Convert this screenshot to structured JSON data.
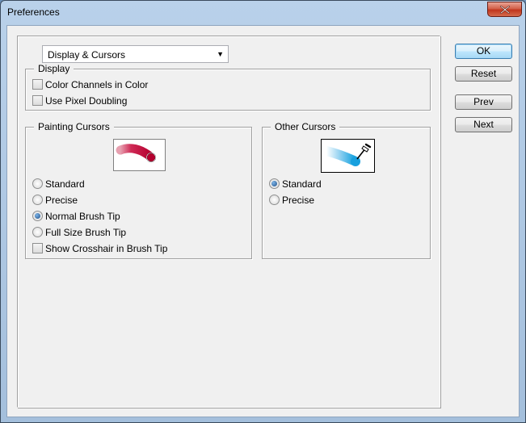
{
  "window": {
    "title": "Preferences"
  },
  "section_select": {
    "value": "Display & Cursors"
  },
  "display_group": {
    "title": "Display",
    "checkboxes": [
      {
        "label": "Color Channels in Color",
        "checked": false
      },
      {
        "label": "Use Pixel Doubling",
        "checked": false
      }
    ]
  },
  "painting_group": {
    "title": "Painting Cursors",
    "preview_icon": "brush-stroke-preview",
    "options": [
      {
        "label": "Standard",
        "selected": false
      },
      {
        "label": "Precise",
        "selected": false
      },
      {
        "label": "Normal Brush Tip",
        "selected": true
      },
      {
        "label": "Full Size Brush Tip",
        "selected": false
      }
    ],
    "crosshair": {
      "label": "Show Crosshair in Brush Tip",
      "checked": false
    }
  },
  "other_group": {
    "title": "Other Cursors",
    "preview_icon": "eyedropper-preview",
    "options": [
      {
        "label": "Standard",
        "selected": true
      },
      {
        "label": "Precise",
        "selected": false
      }
    ]
  },
  "buttons": {
    "ok": "OK",
    "reset": "Reset",
    "prev": "Prev",
    "next": "Next"
  },
  "colors": {
    "accent": "#3c7fb1",
    "brush_stroke": "#c8103c",
    "eyedropper_stroke": "#2aa6e0"
  }
}
